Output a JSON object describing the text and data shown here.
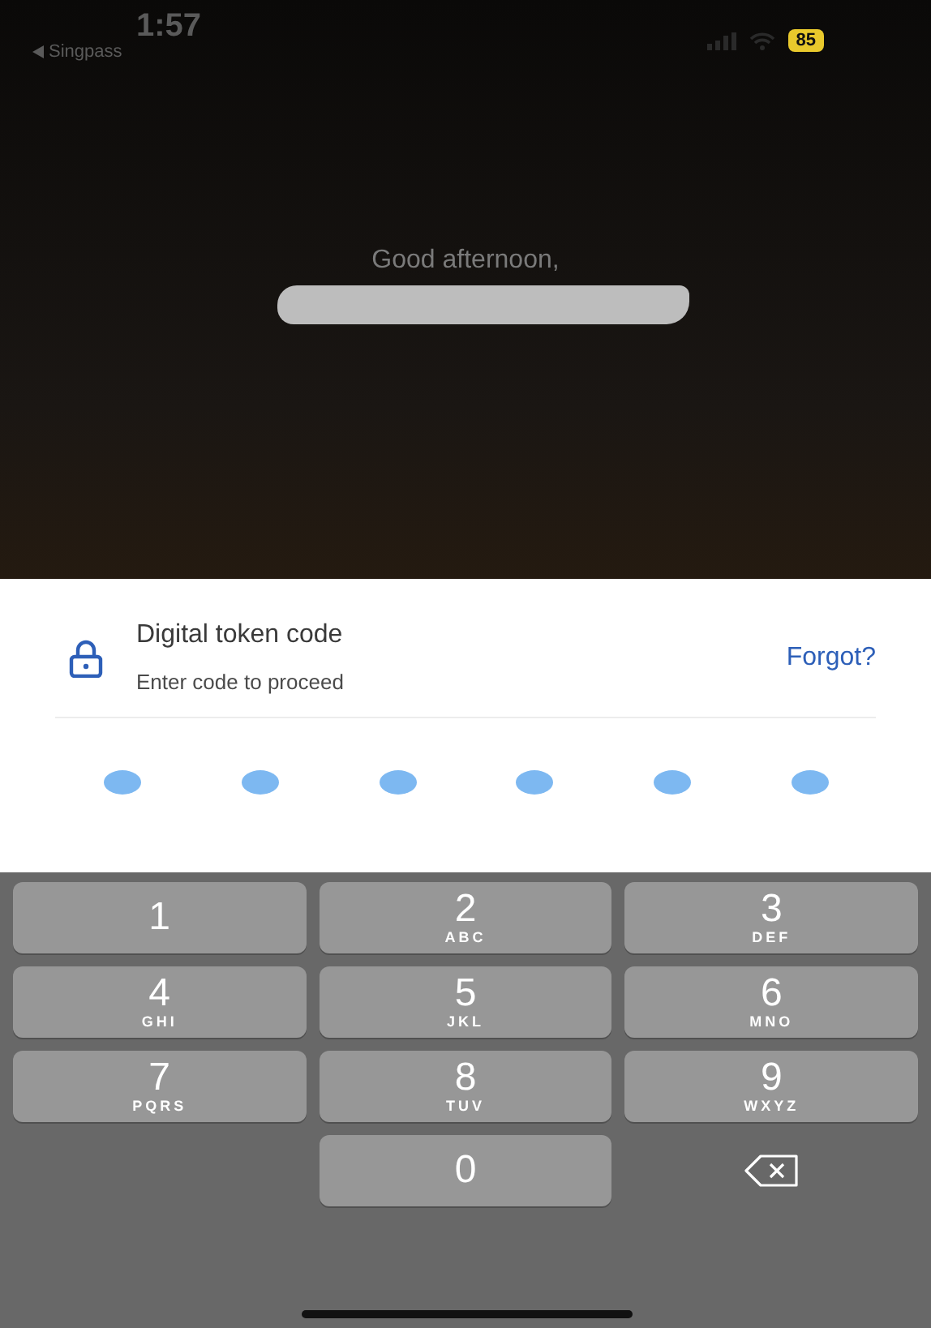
{
  "status_bar": {
    "time": "1:57",
    "back_app": "Singpass",
    "battery": "85"
  },
  "greeting": {
    "text": "Good afternoon,"
  },
  "token_panel": {
    "title": "Digital token code",
    "subtitle": "Enter code to proceed",
    "forgot_link": "Forgot?"
  },
  "pin_dots": [
    {
      "filled": false
    },
    {
      "filled": false
    },
    {
      "filled": false
    },
    {
      "filled": false
    },
    {
      "filled": false
    },
    {
      "filled": false
    }
  ],
  "keypad": [
    {
      "kind": "digit",
      "digit": "1"
    },
    {
      "kind": "digit",
      "digit": "2",
      "letters": "ABC"
    },
    {
      "kind": "digit",
      "digit": "3",
      "letters": "DEF"
    },
    {
      "kind": "digit",
      "digit": "4",
      "letters": "GHI"
    },
    {
      "kind": "digit",
      "digit": "5",
      "letters": "JKL"
    },
    {
      "kind": "digit",
      "digit": "6",
      "letters": "MNO"
    },
    {
      "kind": "digit",
      "digit": "7",
      "letters": "PQRS"
    },
    {
      "kind": "digit",
      "digit": "8",
      "letters": "TUV"
    },
    {
      "kind": "digit",
      "digit": "9",
      "letters": "WXYZ"
    },
    {
      "kind": "blank"
    },
    {
      "kind": "digit",
      "digit": "0"
    },
    {
      "kind": "delete"
    }
  ]
}
